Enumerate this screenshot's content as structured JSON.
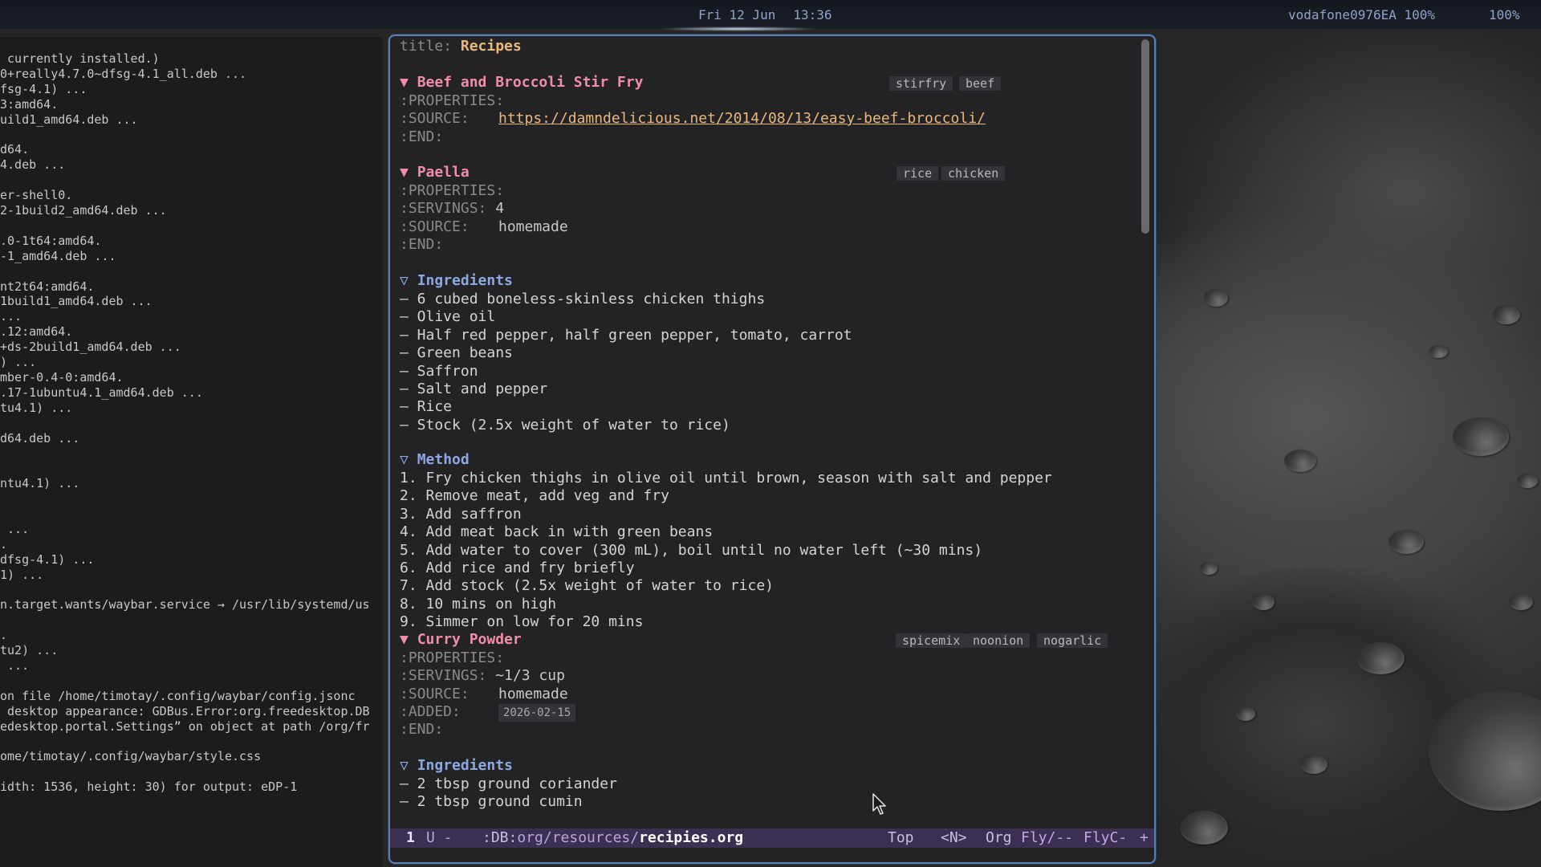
{
  "topbar": {
    "date": "Fri 12 Jun",
    "time": "13:36",
    "network": "vodafone0976EA 100%",
    "battery": "100%"
  },
  "terminal": {
    "lines": [
      " currently installed.)",
      "0+really4.7.0~dfsg-4.1_all.deb ...",
      "fsg-4.1) ...",
      "3:amd64.",
      "uild1_amd64.deb ...",
      "",
      "d64.",
      "4.deb ...",
      "",
      "er-shell0.",
      "2-1build2_amd64.deb ...",
      "",
      ".0-1t64:amd64.",
      "-1_amd64.deb ...",
      "",
      "nt2t64:amd64.",
      "1build1_amd64.deb ...",
      "...",
      ".12:amd64.",
      "+ds-2build1_amd64.deb ...",
      ") ...",
      "mber-0.4-0:amd64.",
      ".17-1ubuntu4.1_amd64.deb ...",
      "tu4.1) ...",
      "",
      "d64.deb ...",
      "",
      "",
      "ntu4.1) ...",
      "",
      "",
      " ...",
      ".",
      "dfsg-4.1) ...",
      "1) ...",
      "",
      "n.target.wants/waybar.service → /usr/lib/systemd/us",
      "",
      ".",
      "tu2) ...",
      " ...",
      "",
      "on file /home/timotay/.config/waybar/config.jsonc",
      " desktop appearance: GDBus.Error:org.freedesktop.DB",
      "edesktop.portal.Settings” on object at path /org/fr",
      "",
      "ome/timotay/.config/waybar/style.css",
      "",
      "idth: 1536, height: 30) for output: eDP-1"
    ]
  },
  "editor": {
    "title_key": "title:",
    "title_value": "Recipes",
    "heading1": "Beef and Broccoli Stir Fry",
    "heading1_tags": [
      "stirfry",
      "beef"
    ],
    "h1_props_open": ":PROPERTIES:",
    "h1_source_key": ":SOURCE:",
    "h1_source_val": "https://damndelicious.net/2014/08/13/easy-beef-broccoli/",
    "h1_props_end": ":END:",
    "heading2": "Paella",
    "heading2_tags": [
      "rice",
      "chicken"
    ],
    "h2_props_open": ":PROPERTIES:",
    "h2_servings_key": ":SERVINGS:",
    "h2_servings_val": "4",
    "h2_source_key": ":SOURCE:",
    "h2_source_val": "homemade",
    "h2_props_end": ":END:",
    "ingredients_label": "Ingredients",
    "ingredients": [
      "– 6 cubed boneless-skinless chicken thighs",
      "– Olive oil",
      "– Half red pepper, half green pepper, tomato, carrot",
      "– Green beans",
      "– Saffron",
      "– Salt and pepper",
      "– Rice",
      "– Stock (2.5x weight of water to rice)"
    ],
    "method_label": "Method",
    "method": [
      "1. Fry chicken thighs in olive oil until brown, season with salt and pepper",
      "2. Remove meat, add veg and fry",
      "3. Add saffron",
      "4. Add meat back in with green beans",
      "5. Add water to cover (300 mL), boil until no water left (~30 mins)",
      "6. Add rice and fry briefly",
      "7. Add stock (2.5x weight of water to rice)",
      "8. 10 mins on high",
      "9. Simmer on low for 20 mins"
    ],
    "heading3": "Curry Powder",
    "heading3_tags": [
      "spicemix",
      "noonion",
      "nogarlic"
    ],
    "h3_props_open": ":PROPERTIES:",
    "h3_servings_key": ":SERVINGS:",
    "h3_servings_val": "~1/3 cup",
    "h3_source_key": ":SOURCE:",
    "h3_source_val": "homemade",
    "h3_added_key": ":ADDED:",
    "h3_added_val": "2026-02-15",
    "h3_props_end": ":END:",
    "ingredients2_label": "Ingredients",
    "ingredients2": [
      "– 2 tbsp ground coriander",
      "– 2 tbsp ground cumin"
    ],
    "arrow_open": "▼",
    "arrow_sub": "▽"
  },
  "modeline": {
    "window_num": "1",
    "state": "U -",
    "path_prefix": ":DB:",
    "path_dir": "org/resources/",
    "filename": "recipies.org",
    "position": "Top",
    "evil_state": "<N>",
    "major_mode": "Org",
    "fly": "Fly/--",
    "flyc": "FlyC-",
    "plus": "+"
  },
  "colors": {
    "heading1": "#f08ea8",
    "heading2": "#8ba9e0",
    "accent": "#e9b97a",
    "modeline_bg": "#3b2f52",
    "window_border": "#5a7fb0"
  }
}
